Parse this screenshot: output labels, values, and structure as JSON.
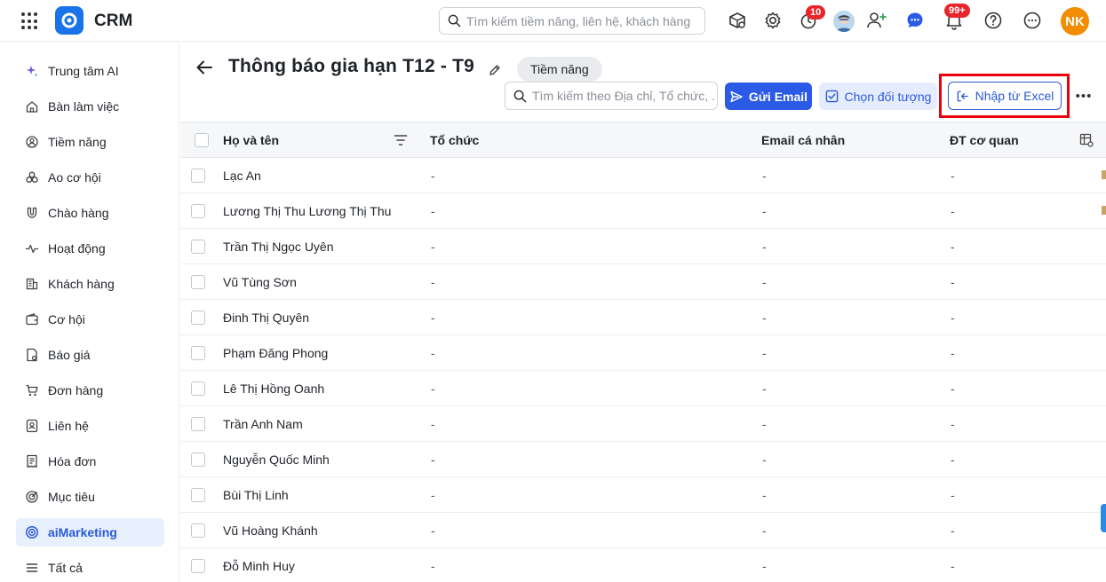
{
  "header": {
    "app_title": "CRM",
    "search_placeholder": "Tìm kiếm tiềm năng, liên hệ, khách hàng",
    "timer_badge": "10",
    "notification_badge": "99+",
    "user_initials": "NK"
  },
  "sidebar": {
    "items": [
      {
        "label": "Trung tâm AI",
        "icon": "sparkle-icon"
      },
      {
        "label": "Bàn làm việc",
        "icon": "home-icon"
      },
      {
        "label": "Tiềm năng",
        "icon": "lead-icon"
      },
      {
        "label": "Ao cơ hội",
        "icon": "pool-icon"
      },
      {
        "label": "Chào hàng",
        "icon": "magnet-icon"
      },
      {
        "label": "Hoạt động",
        "icon": "activity-icon"
      },
      {
        "label": "Khách hàng",
        "icon": "building-icon"
      },
      {
        "label": "Cơ hội",
        "icon": "wallet-icon"
      },
      {
        "label": "Báo giá",
        "icon": "quote-icon"
      },
      {
        "label": "Đơn hàng",
        "icon": "cart-icon"
      },
      {
        "label": "Liên hệ",
        "icon": "contact-icon"
      },
      {
        "label": "Hóa đơn",
        "icon": "invoice-icon"
      },
      {
        "label": "Mục tiêu",
        "icon": "target-icon"
      },
      {
        "label": "aiMarketing",
        "icon": "aimarketing-icon"
      },
      {
        "label": "Tất cả",
        "icon": "menu-icon"
      }
    ],
    "active": "aiMarketing"
  },
  "page": {
    "title": "Thông báo gia hạn T12 - T9",
    "tag": "Tiềm năng",
    "search_placeholder": "Tìm kiếm theo Địa chỉ, Tổ chức, ...",
    "send_email_label": "Gửi Email",
    "choose_label": "Chọn đối tượng",
    "import_label": "Nhập từ Excel"
  },
  "table": {
    "columns": [
      "Họ và tên",
      "Tổ chức",
      "Email cá nhân",
      "ĐT cơ quan"
    ],
    "rows": [
      [
        "Lạc An",
        "-",
        "-",
        "-"
      ],
      [
        "Lương Thị Thu Lương Thị Thu",
        "-",
        "-",
        "-"
      ],
      [
        "Trần Thị Ngọc Uyên",
        "-",
        "-",
        "-"
      ],
      [
        "Vũ Tùng Sơn",
        "-",
        "-",
        "-"
      ],
      [
        "Đinh Thị Quyên",
        "-",
        "-",
        "-"
      ],
      [
        "Phạm Đăng Phong",
        "-",
        "-",
        "-"
      ],
      [
        "Lê Thị Hồng Oanh",
        "-",
        "-",
        "-"
      ],
      [
        "Trần Anh Nam",
        "-",
        "-",
        "-"
      ],
      [
        "Nguyễn Quốc Minh",
        "-",
        "-",
        "-"
      ],
      [
        "Bùi Thị Linh",
        "-",
        "-",
        "-"
      ],
      [
        "Vũ Hoàng Khánh",
        "-",
        "-",
        "-"
      ],
      [
        "Đỗ Minh Huy",
        "-",
        "-",
        "-"
      ]
    ]
  },
  "colors": {
    "primary": "#2b5be6",
    "highlight": "#e8000b",
    "avatar": "#f28c00",
    "badge": "#e8252b"
  }
}
